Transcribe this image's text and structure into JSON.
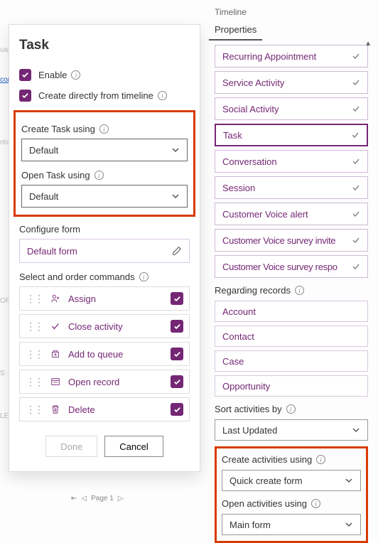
{
  "leftPanel": {
    "title": "Task",
    "enableLabel": "Enable",
    "directlyLabel": "Create directly from timeline",
    "createUsingLabel": "Create Task using",
    "createUsingValue": "Default",
    "openUsingLabel": "Open Task using",
    "openUsingValue": "Default",
    "configureFormLabel": "Configure form",
    "configureFormValue": "Default form",
    "commandsLabel": "Select and order commands",
    "commands": [
      {
        "label": "Assign"
      },
      {
        "label": "Close activity"
      },
      {
        "label": "Add to queue"
      },
      {
        "label": "Open record"
      },
      {
        "label": "Delete"
      }
    ],
    "doneLabel": "Done",
    "cancelLabel": "Cancel"
  },
  "rightPanel": {
    "timelineLabel": "Timeline",
    "propertiesLabel": "Properties",
    "activityTypes": [
      "Recurring Appointment",
      "Service Activity",
      "Social Activity",
      "Task",
      "Conversation",
      "Session",
      "Customer Voice alert",
      "Customer Voice survey invite",
      "Customer Voice survey respo"
    ],
    "regardingLabel": "Regarding records",
    "regardingItems": [
      "Account",
      "Contact",
      "Case",
      "Opportunity"
    ],
    "sortByLabel": "Sort activities by",
    "sortByValue": "Last Updated",
    "createActivitiesLabel": "Create activities using",
    "createActivitiesValue": "Quick create form",
    "openActivitiesLabel": "Open activities using",
    "openActivitiesValue": "Main form"
  },
  "pager": {
    "pageLabel": "Page 1"
  }
}
